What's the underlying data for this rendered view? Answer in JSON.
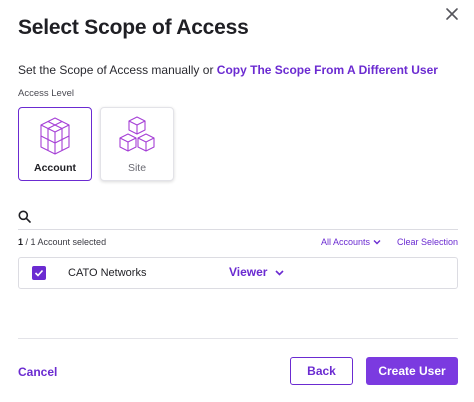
{
  "dialog": {
    "title": "Select Scope of Access",
    "intro_text": "Set the Scope of Access manually or",
    "intro_link": "Copy The Scope From A Different User",
    "close_icon": "close-icon"
  },
  "access_level": {
    "label": "Access Level",
    "options": [
      {
        "label": "Account",
        "icon": "cubes-icon",
        "selected": true
      },
      {
        "label": "Site",
        "icon": "cubes-pyramid-icon",
        "selected": false
      }
    ]
  },
  "search": {
    "icon": "search-icon",
    "value": "",
    "placeholder": ""
  },
  "selection": {
    "count": "1",
    "summary": " / 1 Account selected",
    "filter_label": "All Accounts",
    "clear_label": "Clear Selection"
  },
  "rows": [
    {
      "name": "CATO Networks",
      "role": "Viewer",
      "checked": true
    }
  ],
  "footer": {
    "cancel_label": "Cancel",
    "back_label": "Back",
    "create_label": "Create User"
  },
  "colors": {
    "accent": "#6b2bd1",
    "primary_button": "#7b3ae0"
  }
}
